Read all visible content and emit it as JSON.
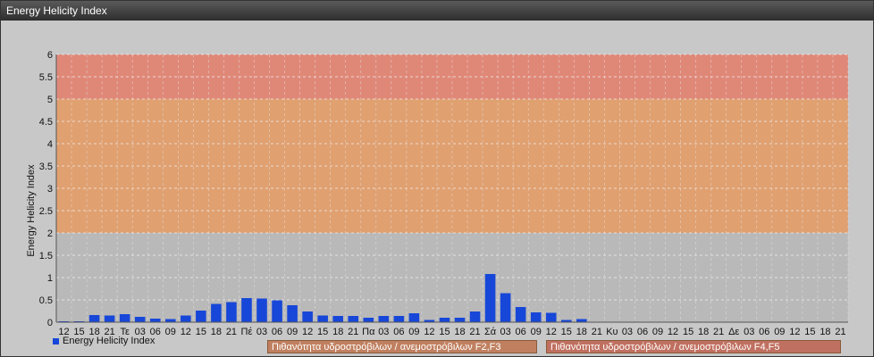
{
  "window": {
    "title": "Energy Helicity Index"
  },
  "legend": {
    "series_label": "Energy Helicity Index",
    "series_color": "#1747d8"
  },
  "bands": [
    {
      "label": "Πιθανότητα υδροστρόβιλων / ανεμοστρόβιλων F2,F3",
      "from": 2,
      "to": 5,
      "color": "#e0a070",
      "label_bg": "#c08060"
    },
    {
      "label": "Πιθανότητα υδροστρόβιλων / ανεμοστρόβιλων F4,F5",
      "from": 5,
      "to": 6,
      "color": "#e08878",
      "label_bg": "#c07060"
    }
  ],
  "chart_data": {
    "type": "bar",
    "title": "",
    "xlabel": "",
    "ylabel": "Energy Helicity Index",
    "ylim": [
      0,
      6
    ],
    "yticks": [
      "0",
      "0.5",
      "1",
      "1.5",
      "2",
      "2.5",
      "3",
      "3.5",
      "4",
      "4.5",
      "5",
      "5.5",
      "6"
    ],
    "grid": true,
    "categories": [
      "12",
      "15",
      "18",
      "21",
      "Τε",
      "03",
      "06",
      "09",
      "12",
      "15",
      "18",
      "21",
      "Πέ",
      "03",
      "06",
      "09",
      "12",
      "15",
      "18",
      "21",
      "Πα",
      "03",
      "06",
      "09",
      "12",
      "15",
      "18",
      "21",
      "Σά",
      "03",
      "06",
      "09",
      "12",
      "15",
      "18",
      "21",
      "Κυ",
      "03",
      "06",
      "09",
      "12",
      "15",
      "18",
      "21",
      "Δε",
      "03",
      "06",
      "09",
      "12",
      "15",
      "18",
      "21"
    ],
    "series": [
      {
        "name": "Energy Helicity Index",
        "color": "#1747d8",
        "values": [
          0.02,
          0.02,
          0.16,
          0.15,
          0.18,
          0.12,
          0.08,
          0.07,
          0.15,
          0.26,
          0.41,
          0.45,
          0.54,
          0.53,
          0.49,
          0.38,
          0.24,
          0.15,
          0.14,
          0.14,
          0.1,
          0.14,
          0.14,
          0.2,
          0.05,
          0.1,
          0.1,
          0.24,
          1.08,
          0.65,
          0.34,
          0.22,
          0.21,
          0.05,
          0.07,
          0.01,
          0.01,
          0.01,
          0.01,
          0.01,
          0.01,
          0.01,
          0.01,
          0.01,
          0.01,
          0.01,
          0.01,
          0.01,
          0.01,
          0.01,
          0.01,
          0.01
        ]
      }
    ]
  }
}
